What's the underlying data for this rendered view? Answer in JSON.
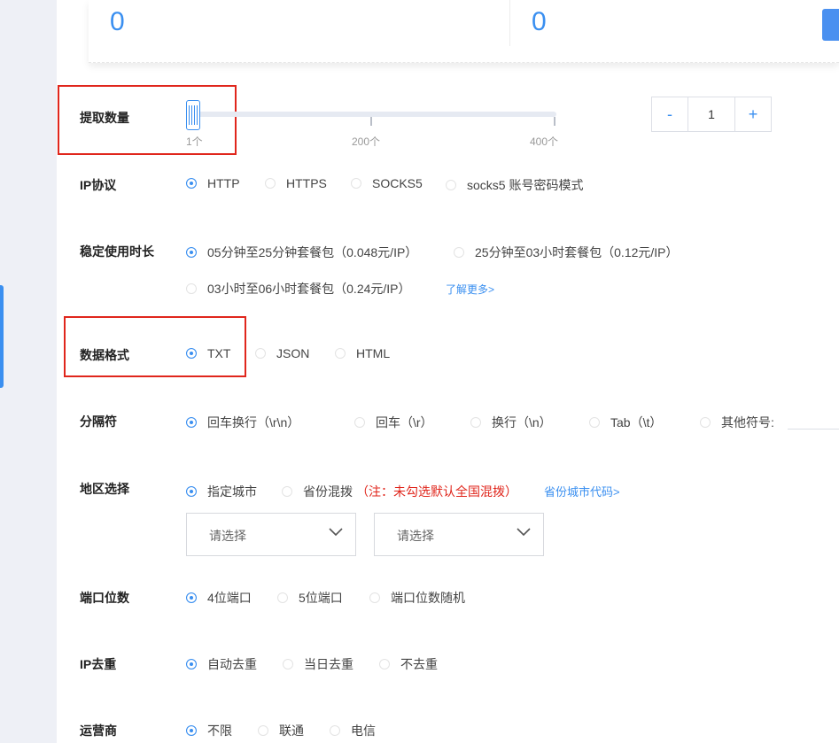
{
  "stats": {
    "value_left": "0",
    "value_right": "0"
  },
  "quantity": {
    "label": "提取数量",
    "slider_min_label": "1个",
    "slider_mid_label": "200个",
    "slider_max_label": "400个",
    "slider_value": 1,
    "stepper_minus": "-",
    "stepper_value": "1",
    "stepper_plus": "+"
  },
  "protocol": {
    "label": "IP协议",
    "options": [
      "HTTP",
      "HTTPS",
      "SOCKS5",
      "socks5 账号密码模式"
    ],
    "selected": "HTTP"
  },
  "duration": {
    "label": "稳定使用时长",
    "options": [
      "05分钟至25分钟套餐包（0.048元/IP）",
      "25分钟至03小时套餐包（0.12元/IP）",
      "03小时至06小时套餐包（0.24元/IP）"
    ],
    "selected": "05分钟至25分钟套餐包（0.048元/IP）",
    "more_link": "了解更多>"
  },
  "format": {
    "label": "数据格式",
    "options": [
      "TXT",
      "JSON",
      "HTML"
    ],
    "selected": "TXT"
  },
  "separator": {
    "label": "分隔符",
    "options": [
      "回车换行（\\r\\n）",
      "回车（\\r）",
      "换行（\\n）",
      "Tab（\\t）",
      "其他符号:"
    ],
    "selected": "回车换行（\\r\\n）"
  },
  "region": {
    "label": "地区选择",
    "options": [
      "指定城市",
      "省份混拨"
    ],
    "selected": "指定城市",
    "note": "（注：未勾选默认全国混拨）",
    "code_link": "省份城市代码>",
    "select_placeholder_1": "请选择",
    "select_placeholder_2": "请选择"
  },
  "port": {
    "label": "端口位数",
    "options": [
      "4位端口",
      "5位端口",
      "端口位数随机"
    ],
    "selected": "4位端口"
  },
  "dedup": {
    "label": "IP去重",
    "options": [
      "自动去重",
      "当日去重",
      "不去重"
    ],
    "selected": "自动去重"
  },
  "carrier": {
    "label": "运营商",
    "options": [
      "不限",
      "联通",
      "电信"
    ],
    "selected": "不限"
  },
  "colors": {
    "accent": "#3a8ff0",
    "highlight": "#e0261c",
    "sidebar": "#eef0f6"
  }
}
